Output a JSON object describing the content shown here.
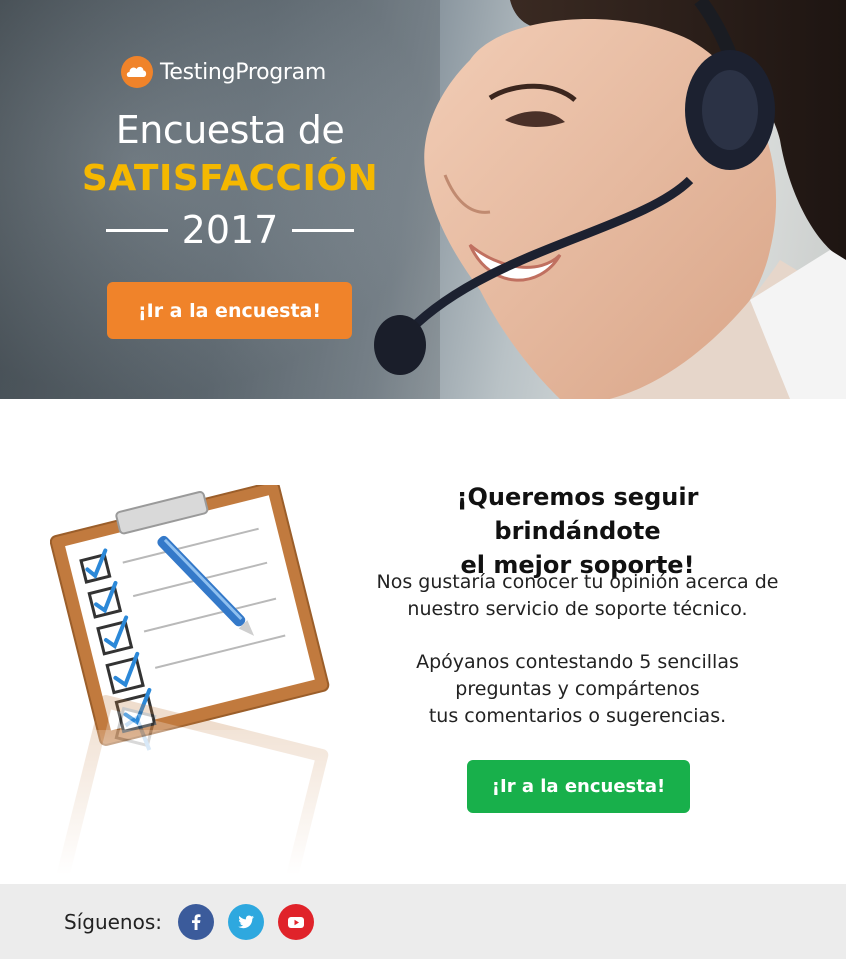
{
  "brand": {
    "name_part1": "Testing",
    "name_part2": "Program",
    "icon": "cloud-logo-icon",
    "color": "#f0832a"
  },
  "hero": {
    "title_line1": "Encuesta de",
    "title_line2": "SATISFACCIÓN",
    "year": "2017",
    "cta_label": "¡Ir a la encuesta!",
    "cta_color": "#f0832a",
    "accent_color": "#f5b800"
  },
  "content": {
    "headline_line1": "¡Queremos seguir brindándote",
    "headline_line2": "el mejor soporte!",
    "paragraph1_line1": "Nos gustaría conocer tu opinión acerca de",
    "paragraph1_line2": "nuestro servicio de soporte técnico.",
    "paragraph2_line1": "Apóyanos contestando 5 sencillas",
    "paragraph2_line2": "preguntas y compártenos",
    "paragraph2_line3": "tus comentarios o sugerencias.",
    "cta_label": "¡Ir a la encuesta!",
    "cta_color": "#18b04b",
    "illustration_icon": "clipboard-checklist-icon"
  },
  "footer": {
    "label": "Síguenos:",
    "social": [
      {
        "name": "facebook-icon",
        "color": "#3b5b9b"
      },
      {
        "name": "twitter-icon",
        "color": "#2ea8df"
      },
      {
        "name": "youtube-icon",
        "color": "#e0232a"
      }
    ]
  }
}
